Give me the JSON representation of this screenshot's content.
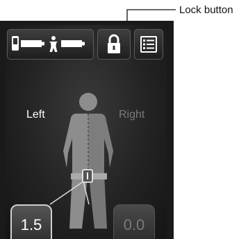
{
  "callout": {
    "label": "Lock button"
  },
  "top_bar": {
    "status_icon": "device-battery-person-battery-icon",
    "lock_icon": "padlock-icon",
    "menu_icon": "list-menu-icon"
  },
  "sides": {
    "left": "Left",
    "right": "Right"
  },
  "values": {
    "left": "1.5",
    "right": "0.0"
  },
  "colors": {
    "background": "#1a1a1a",
    "figure": "#8d8d8d",
    "active_text": "#ffffff",
    "inactive_text": "#7a7a7a"
  }
}
